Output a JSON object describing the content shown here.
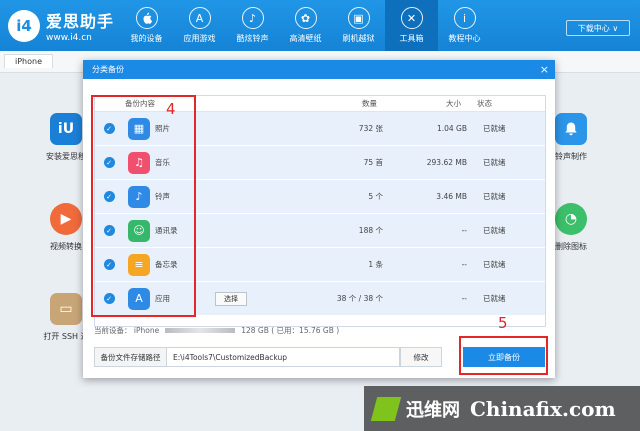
{
  "app": {
    "logo_mark": "i4",
    "title": "爱思助手",
    "url": "www.i4.cn"
  },
  "nav": [
    {
      "label": "我的设备",
      "icon": "apple-icon",
      "glyph": ""
    },
    {
      "label": "应用游戏",
      "icon": "appstore-icon",
      "glyph": "A"
    },
    {
      "label": "酷炫铃声",
      "icon": "bell-icon",
      "glyph": "♪"
    },
    {
      "label": "高清壁纸",
      "icon": "flower-icon",
      "glyph": "✿"
    },
    {
      "label": "刷机越狱",
      "icon": "box-icon",
      "glyph": "▣"
    },
    {
      "label": "工具箱",
      "icon": "tools-icon",
      "glyph": "✕"
    },
    {
      "label": "教程中心",
      "icon": "info-icon",
      "glyph": "i"
    }
  ],
  "download_label": "下载中心 ∨",
  "device_tab": "iPhone",
  "tiles": [
    {
      "label": "安装爱思移",
      "color": "#1a7fd6",
      "glyph": "iU"
    },
    {
      "label": "视频转换",
      "color": "#f06a3a",
      "glyph": "▶"
    },
    {
      "label": "打开 SSH 通",
      "color": "#c8a577",
      "glyph": "▭"
    },
    {
      "label": "铃声制作",
      "color": "#2b95e9",
      "glyph": "🔔"
    },
    {
      "label": "删除图标",
      "color": "#3cbf6a",
      "glyph": "◔"
    }
  ],
  "dialog": {
    "title": "分类备份",
    "close": "×",
    "headers": {
      "content": "备份内容",
      "count": "数量",
      "size": "大小",
      "status": "状态"
    },
    "rows": [
      {
        "name": "照片",
        "count": "732 张",
        "size": "1.04 GB",
        "status": "已就绪",
        "icon": "photos-icon",
        "color": "#2f8ae5",
        "glyph": "▦",
        "select": ""
      },
      {
        "name": "音乐",
        "count": "75 首",
        "size": "293.62 MB",
        "status": "已就绪",
        "icon": "music-icon",
        "color": "#f0506e",
        "glyph": "♫",
        "select": ""
      },
      {
        "name": "铃声",
        "count": "5 个",
        "size": "3.46 MB",
        "status": "已就绪",
        "icon": "bell-icon",
        "color": "#2f8ae5",
        "glyph": "♪",
        "select": ""
      },
      {
        "name": "通讯录",
        "count": "188 个",
        "size": "--",
        "status": "已就绪",
        "icon": "contacts-icon",
        "color": "#35b86b",
        "glyph": "☺",
        "select": ""
      },
      {
        "name": "备忘录",
        "count": "1 条",
        "size": "--",
        "status": "已就绪",
        "icon": "notes-icon",
        "color": "#f5a623",
        "glyph": "≡",
        "select": ""
      },
      {
        "name": "应用",
        "count": "38 个 / 38 个",
        "size": "--",
        "status": "已就绪",
        "icon": "appstore-icon",
        "color": "#2f8ae5",
        "glyph": "A",
        "select": "选择"
      }
    ],
    "device_prefix": "当前设备： iPhone",
    "storage": "128 GB ( 已用：15.76 GB )",
    "path_label": "备份文件存储路径",
    "path_value": "E:\\i4Tools7\\CustomizedBackup",
    "modify_label": "修改",
    "backup_label": "立即备份"
  },
  "annotations": {
    "box1_number": "4",
    "box2_number": "5"
  },
  "watermark": {
    "cn": "迅维网",
    "en": "Chinafix.com"
  }
}
